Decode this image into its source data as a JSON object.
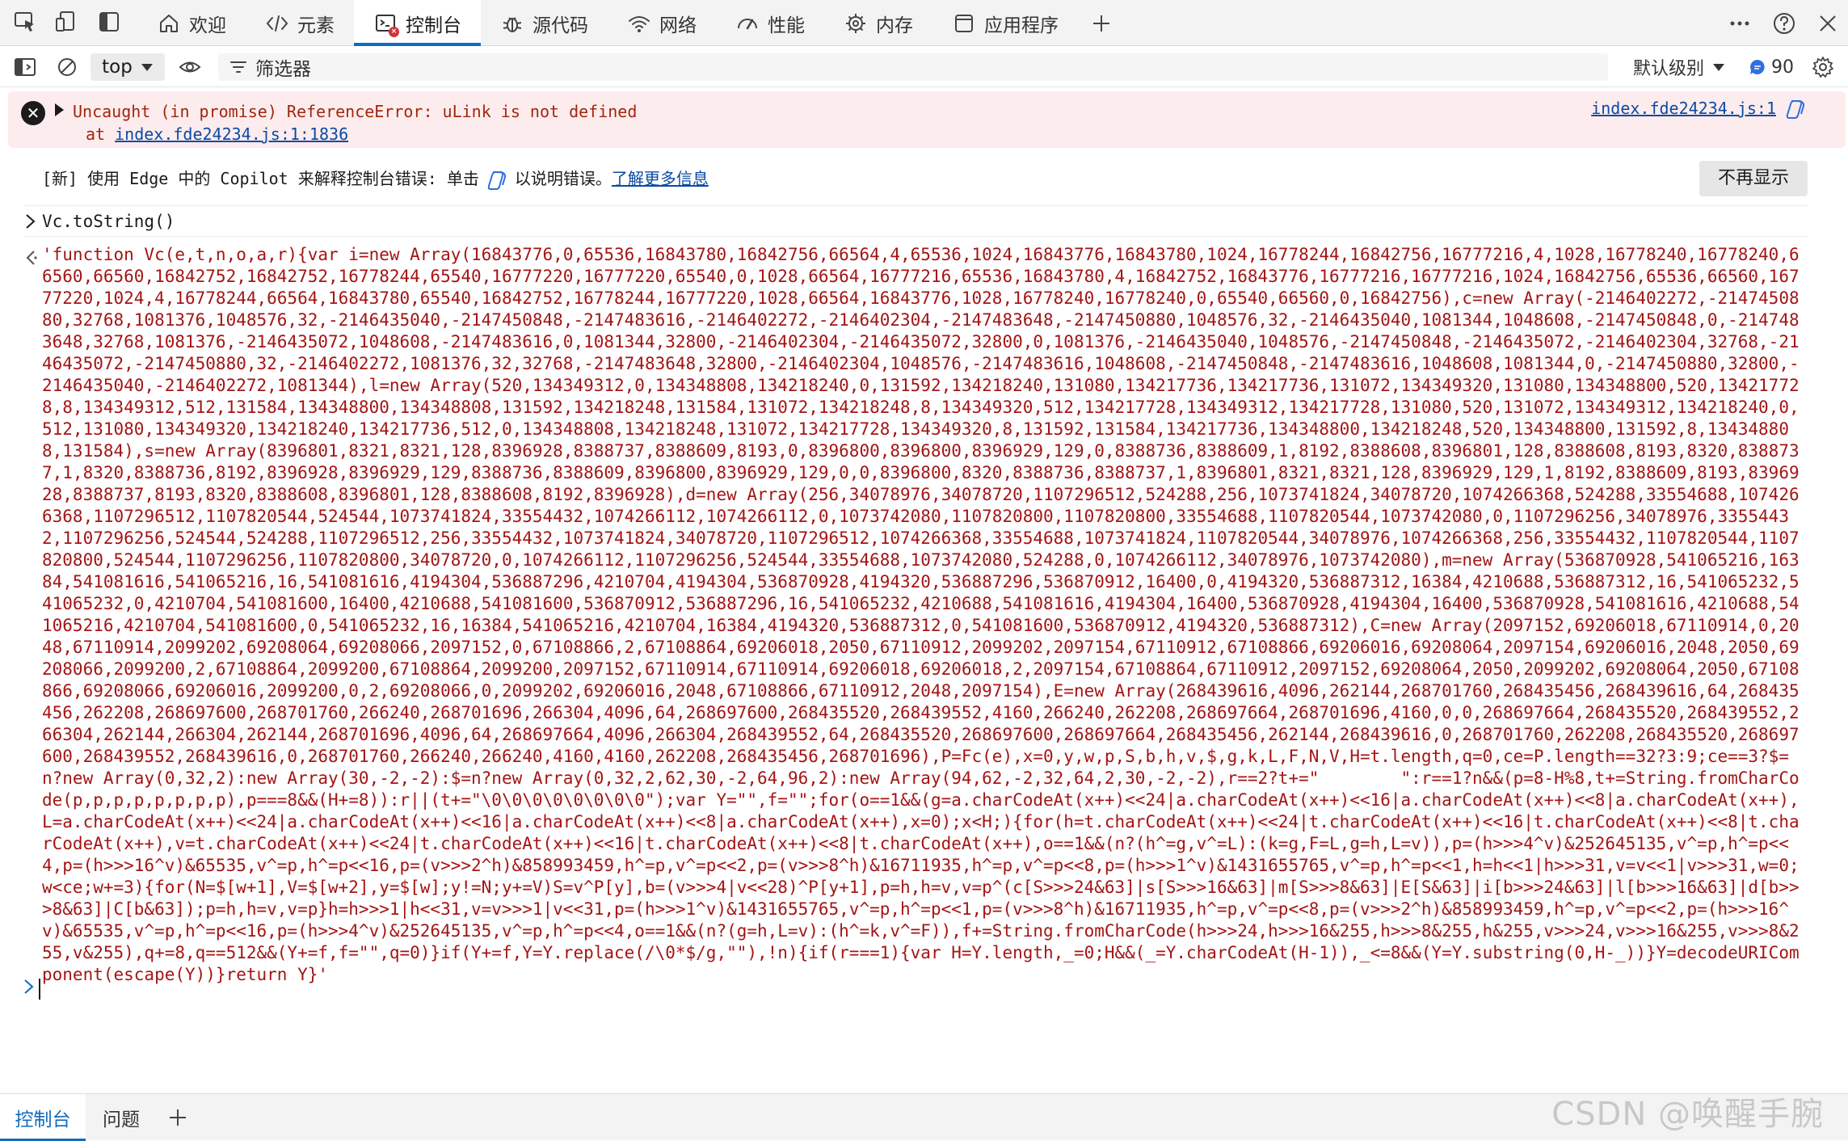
{
  "tabs": [
    {
      "label": "欢迎",
      "icon": "home-icon"
    },
    {
      "label": "元素",
      "icon": "code-icon"
    },
    {
      "label": "控制台",
      "icon": "console-icon",
      "active": true
    },
    {
      "label": "源代码",
      "icon": "bug-icon"
    },
    {
      "label": "网络",
      "icon": "wifi-icon"
    },
    {
      "label": "性能",
      "icon": "performance-icon"
    },
    {
      "label": "内存",
      "icon": "memory-icon"
    },
    {
      "label": "应用程序",
      "icon": "application-icon"
    }
  ],
  "toolbar": {
    "context": "top",
    "filter_placeholder": "筛选器",
    "levels": "默认级别",
    "message_count": "90"
  },
  "error": {
    "message": "Uncaught (in promise) ReferenceError: uLink is not defined",
    "at_prefix": "at ",
    "at_location": "index.fde24234.js:1:1836",
    "source": "index.fde24234.js:1"
  },
  "banner": {
    "text_before": "[新] 使用 Edge 中的 Copilot 来解释控制台错误: 单击",
    "text_after": "以说明错误。",
    "link": "了解更多信息",
    "dismiss": "不再显示"
  },
  "console": {
    "command": "Vc.toString()",
    "result": "'function Vc(e,t,n,o,a,r){var i=new Array(16843776,0,65536,16843780,16842756,66564,4,65536,1024,16843776,16843780,1024,16778244,16842756,16777216,4,1028,16778240,16778240,66560,66560,16842752,16842752,16778244,65540,16777220,16777220,65540,0,1028,66564,16777216,65536,16843780,4,16842752,16843776,16777216,16777216,1024,16842756,65536,66560,16777220,1024,4,16778244,66564,16843780,65540,16842752,16778244,16777220,1028,66564,16843776,1028,16778240,16778240,0,65540,66560,0,16842756),c=new Array(-2146402272,-2147450880,32768,1081376,1048576,32,-2146435040,-2147450848,-2147483616,-2146402272,-2146402304,-2147483648,-2147450880,1048576,32,-2146435040,1081344,1048608,-2147450848,0,-2147483648,32768,1081376,-2146435072,1048608,-2147483616,0,1081344,32800,-2146402304,-2146435072,32800,0,1081376,-2146435040,1048576,-2147450848,-2146435072,-2146402304,32768,-2146435072,-2147450880,32,-2146402272,1081376,32,32768,-2147483648,32800,-2146402304,1048576,-2147483616,1048608,-2147450848,-2147483616,1048608,1081344,0,-2147450880,32800,-2146435040,-2146402272,1081344),l=new Array(520,134349312,0,134348808,134218240,0,131592,134218240,131080,134217736,134217736,131072,134349320,131080,134348800,520,134217728,8,134349312,512,131584,134348800,134348808,131592,134218248,131584,131072,134218248,8,134349320,512,134217728,134349312,134217728,131080,520,131072,134349312,134218240,0,512,131080,134349320,134218240,134217736,512,0,134348808,134218248,131072,134217728,134349320,8,131592,131584,134217736,134348800,134218248,520,134348800,131592,8,134348808,131584),s=new Array(8396801,8321,8321,128,8396928,8388737,8388609,8193,0,8396800,8396800,8396929,129,0,8388736,8388609,1,8192,8388608,8396801,128,8388608,8193,8320,8388737,1,8320,8388736,8192,8396928,8396929,129,8388736,8388609,8396800,8396929,129,0,0,8396800,8320,8388736,8388737,1,8396801,8321,8321,128,8396929,129,1,8192,8388609,8193,8396928,8388737,8193,8320,8388608,8396801,128,8388608,8192,8396928),d=new Array(256,34078976,34078720,1107296512,524288,256,1073741824,34078720,1074266368,524288,33554688,1074266368,1107296512,1107820544,524544,1073741824,33554432,1074266112,1074266112,0,1073742080,1107820800,1107820800,33554688,1107820544,1073742080,0,1107296256,34078976,33554432,1107296256,524544,524288,1107296512,256,33554432,1073741824,34078720,1107296512,1074266368,33554688,1073741824,1107820544,34078976,1074266368,256,33554432,1107820544,1107820800,524544,1107296256,1107820800,34078720,0,1074266112,1107296256,524544,33554688,1073742080,524288,0,1074266112,34078976,1073742080),m=new Array(536870928,541065216,16384,541081616,541065216,16,541081616,4194304,536887296,4210704,4194304,536870928,4194320,536887296,536870912,16400,0,4194320,536887312,16384,4210688,536887312,16,541065232,541065232,0,4210704,541081600,16400,4210688,541081600,536870912,536887296,16,541065232,4210688,541081616,4194304,16400,536870928,4194304,16400,536870928,541081616,4210688,541065216,4210704,541081600,0,541065232,16,16384,541065216,4210704,16384,4194320,536887312,0,541081600,536870912,4194320,536887312),C=new Array(2097152,69206018,67110914,0,2048,67110914,2099202,69208064,69208066,2097152,0,67108866,2,67108864,69206018,2050,67110912,2099202,2097154,67110912,67108866,69206016,69208064,2097154,69206016,2048,2050,69208066,2099200,2,67108864,2099200,67108864,2099200,2097152,67110914,67110914,69206018,69206018,2,2097154,67108864,67110912,2097152,69208064,2050,2099202,69208064,2050,67108866,69208066,69206016,2099200,0,2,69208066,0,2099202,69206016,2048,67108866,67110912,2048,2097154),E=new Array(268439616,4096,262144,268701760,268435456,268439616,64,268435456,262208,268697600,268701760,266240,268701696,266304,4096,64,268697600,268435520,268439552,4160,266240,262208,268697664,268701696,4160,0,0,268697664,268435520,268439552,266304,262144,266304,262144,268701696,4096,64,268697664,4096,266304,268439552,64,268435520,268697600,268697664,268435456,262144,268439616,0,268701760,262208,268435520,268697600,268439552,268439616,0,268701760,266240,266240,4160,4160,262208,268435456,268701696),P=Fc(e),x=0,y,w,p,S,b,h,v,$,g,k,L,F,N,V,H=t.length,q=0,ce=P.length==32?3:9;ce==3?$=n?new Array(0,32,2):new Array(30,-2,-2):$=n?new Array(0,32,2,62,30,-2,64,96,2):new Array(94,62,-2,32,64,2,30,-2,-2),r==2?t+=\"        \":r==1?n&&(p=8-H%8,t+=String.fromCharCode(p,p,p,p,p,p,p,p),p===8&&(H+=8)):r||(t+=\"\\0\\0\\0\\0\\0\\0\\0\\0\");var Y=\"\",f=\"\";for(o==1&&(g=a.charCodeAt(x++)<<24|a.charCodeAt(x++)<<16|a.charCodeAt(x++)<<8|a.charCodeAt(x++),L=a.charCodeAt(x++)<<24|a.charCodeAt(x++)<<16|a.charCodeAt(x++)<<8|a.charCodeAt(x++),x=0);x<H;){for(h=t.charCodeAt(x++)<<24|t.charCodeAt(x++)<<16|t.charCodeAt(x++)<<8|t.charCodeAt(x++),v=t.charCodeAt(x++)<<24|t.charCodeAt(x++)<<16|t.charCodeAt(x++)<<8|t.charCodeAt(x++),o==1&&(n?(h^=g,v^=L):(k=g,F=L,g=h,L=v)),p=(h>>>4^v)&252645135,v^=p,h^=p<<4,p=(h>>>16^v)&65535,v^=p,h^=p<<16,p=(v>>>2^h)&858993459,h^=p,v^=p<<2,p=(v>>>8^h)&16711935,h^=p,v^=p<<8,p=(h>>>1^v)&1431655765,v^=p,h^=p<<1,h=h<<1|h>>>31,v=v<<1|v>>>31,w=0;w<ce;w+=3){for(N=$[w+1],V=$[w+2],y=$[w];y!=N;y+=V)S=v^P[y],b=(v>>>4|v<<28)^P[y+1],p=h,h=v,v=p^(c[S>>>24&63]|s[S>>>16&63]|m[S>>>8&63]|E[S&63]|i[b>>>24&63]|l[b>>>16&63]|d[b>>>8&63]|C[b&63]);p=h,h=v,v=p}h=h>>>1|h<<31,v=v>>>1|v<<31,p=(h>>>1^v)&1431655765,v^=p,h^=p<<1,p=(v>>>8^h)&16711935,h^=p,v^=p<<8,p=(v>>>2^h)&858993459,h^=p,v^=p<<2,p=(h>>>16^v)&65535,v^=p,h^=p<<16,p=(h>>>4^v)&252645135,v^=p,h^=p<<4,o==1&&(n?(g=h,L=v):(h^=k,v^=F)),f+=String.fromCharCode(h>>>24,h>>>16&255,h>>>8&255,h&255,v>>>24,v>>>16&255,v>>>8&255,v&255),q+=8,q==512&&(Y+=f,f=\"\",q=0)}if(Y+=f,Y=Y.replace(/\\0*$/g,\"\"),!n){if(r===1){var H=Y.length,_=0;H&&(_=Y.charCodeAt(H-1)),_<=8&&(Y=Y.substring(0,H-_))}Y=decodeURIComponent(escape(Y))}return Y}'"
  },
  "drawer": {
    "tabs": [
      "控制台",
      "问题"
    ]
  },
  "watermark": "CSDN @唤醒手腕"
}
